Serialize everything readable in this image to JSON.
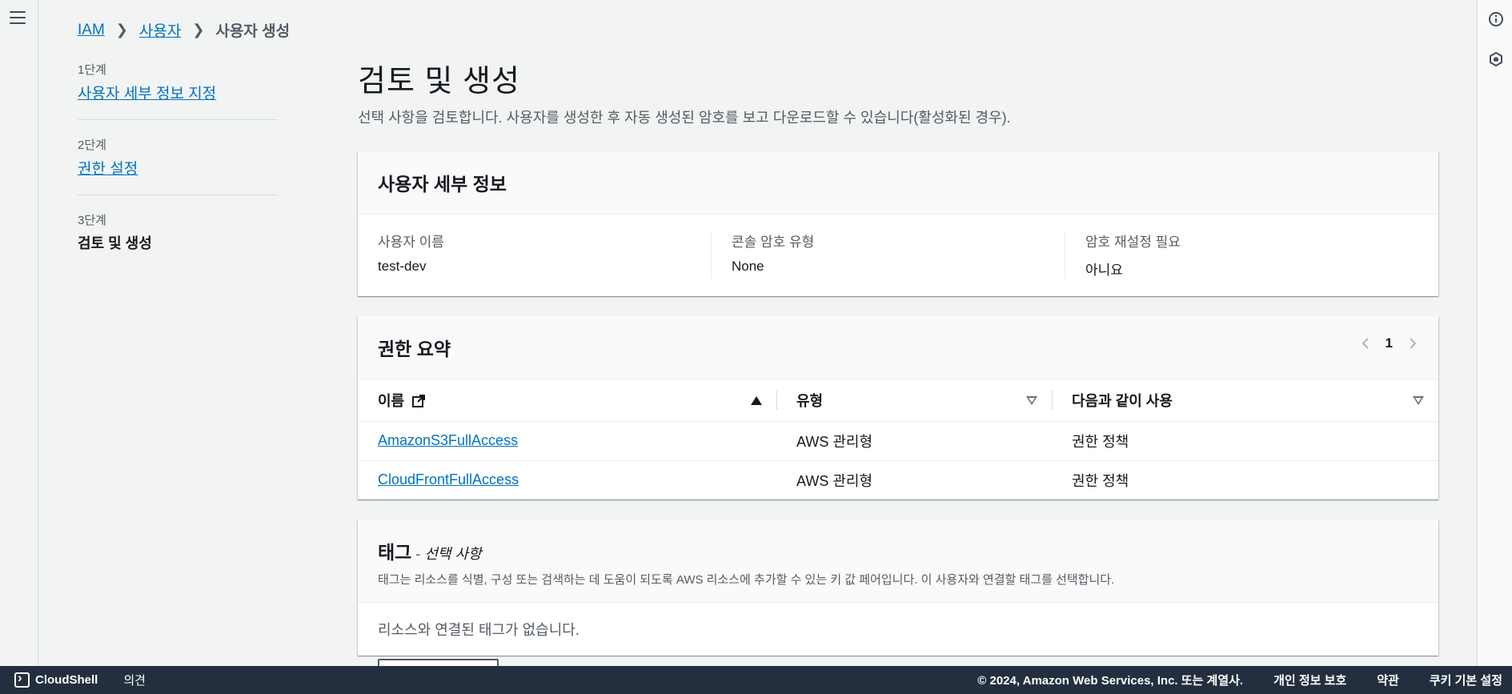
{
  "breadcrumb": {
    "items": [
      "IAM",
      "사용자"
    ],
    "current": "사용자 생성"
  },
  "steps": [
    {
      "num": "1단계",
      "label": "사용자 세부 정보 지정"
    },
    {
      "num": "2단계",
      "label": "권한 설정"
    },
    {
      "num": "3단계",
      "label": "검토 및 생성"
    }
  ],
  "page": {
    "title": "검토 및 생성",
    "description": "선택 사항을 검토합니다. 사용자를 생성한 후 자동 생성된 암호를 보고 다운로드할 수 있습니다(활성화된 경우)."
  },
  "user_details": {
    "title": "사용자 세부 정보",
    "fields": [
      {
        "label": "사용자 이름",
        "value": "test-dev"
      },
      {
        "label": "콘솔 암호 유형",
        "value": "None"
      },
      {
        "label": "암호 재설정 필요",
        "value": "아니요"
      }
    ]
  },
  "permissions": {
    "title": "권한 요약",
    "page_number": "1",
    "columns": [
      "이름",
      "유형",
      "다음과 같이 사용"
    ],
    "rows": [
      {
        "name": "AmazonS3FullAccess",
        "type": "AWS 관리형",
        "used_as": "권한 정책"
      },
      {
        "name": "CloudFrontFullAccess",
        "type": "AWS 관리형",
        "used_as": "권한 정책"
      }
    ]
  },
  "tags": {
    "title": "태그",
    "dash": " - ",
    "optional": "선택 사항",
    "description": "태그는 리소스를 식별, 구성 또는 검색하는 데 도움이 되도록 AWS 리소스에 추가할 수 있는 키 값 페어입니다. 이 사용자와 연결할 태그를 선택합니다.",
    "empty": "리소스와 연결된 태그가 없습니다."
  },
  "footer": {
    "cloudshell": "CloudShell",
    "feedback": "의견",
    "copyright": "© 2024, Amazon Web Services, Inc. 또는 계열사.",
    "privacy": "개인 정보 보호",
    "terms": "약관",
    "cookies": "쿠키 기본 설정"
  },
  "colors": {
    "link": "#0073bb",
    "footer_bg": "#232f3e",
    "background": "#f2f3f3"
  }
}
